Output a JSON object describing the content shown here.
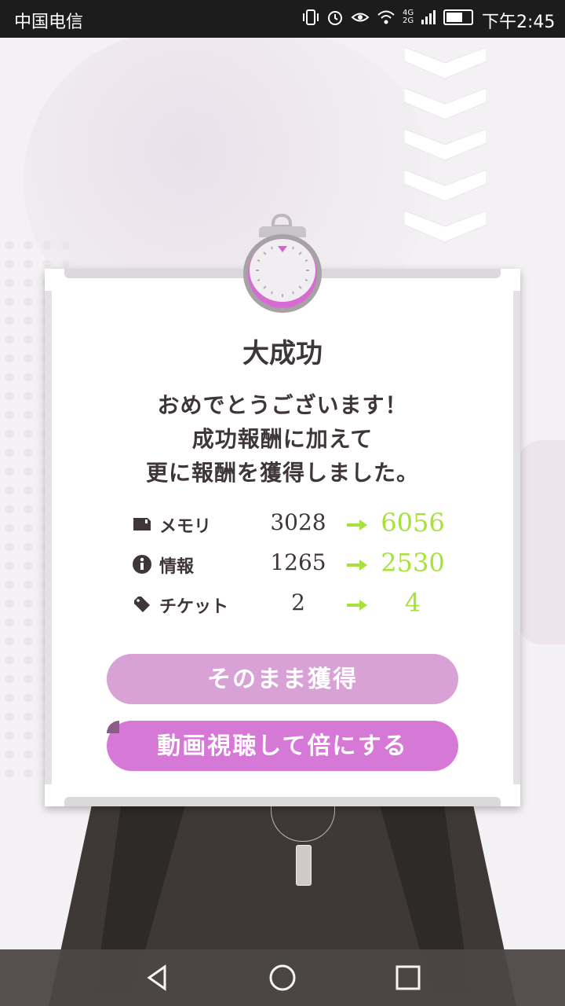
{
  "status_bar": {
    "carrier": "中国电信",
    "time": "下午2:45",
    "icons": [
      "vibrate-icon",
      "alarm-icon",
      "eye-icon",
      "wifi-icon",
      "signal-icon",
      "battery-icon"
    ],
    "network_top": "4G",
    "network_bottom": "2G"
  },
  "dialog": {
    "title": "大成功",
    "message_lines": [
      "おめでとうございます！",
      "成功報酬に加えて",
      "更に報酬を獲得しました。"
    ],
    "rewards": [
      {
        "icon": "memory-card-icon",
        "name": "メモリ",
        "before": "3028",
        "after": "6056"
      },
      {
        "icon": "info-icon",
        "name": "情報",
        "before": "1265",
        "after": "2530"
      },
      {
        "icon": "ticket-icon",
        "name": "チケット",
        "before": "2",
        "after": "4"
      }
    ],
    "buttons": {
      "claim": "そのまま獲得",
      "watch_video": "動画視聴して倍にする"
    }
  },
  "colors": {
    "accent_green": "#a6e23a",
    "button_light_pink": "#d9a2d6",
    "button_pink": "#d578d6",
    "text_dark": "#3f3638"
  },
  "navigation_bar": {
    "icons": [
      "back-icon",
      "home-icon",
      "recents-icon"
    ]
  }
}
